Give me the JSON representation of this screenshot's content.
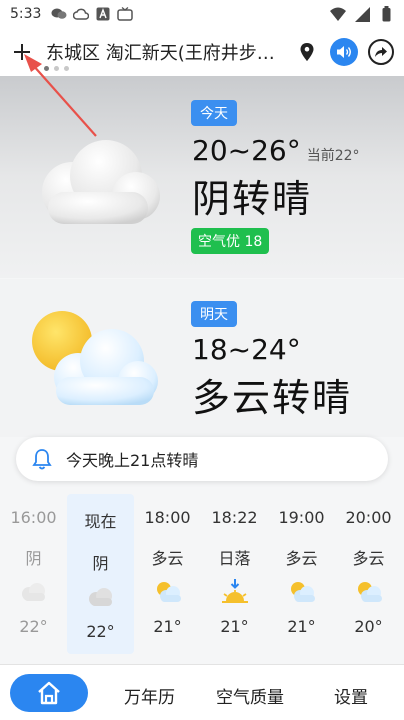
{
  "status_bar": {
    "time": "5:33"
  },
  "header": {
    "location": "东城区 淘汇新天(王府井步…"
  },
  "today": {
    "tag": "今天",
    "temp_range": "20~26°",
    "current": "当前22°",
    "condition": "阴转晴",
    "aqi": "空气优 18"
  },
  "tomorrow": {
    "tag": "明天",
    "temp_range": "18~24°",
    "condition": "多云转晴"
  },
  "alert": {
    "text": "今天晚上21点转晴"
  },
  "hourly": [
    {
      "time": "16:00",
      "cond": "阴",
      "temp": "22°",
      "icon": "cloud-icon"
    },
    {
      "time": "现在",
      "cond": "阴",
      "temp": "22°",
      "icon": "cloud-icon"
    },
    {
      "time": "18:00",
      "cond": "多云",
      "temp": "21°",
      "icon": "partly-cloudy-icon"
    },
    {
      "time": "18:22",
      "cond": "日落",
      "temp": "21°",
      "icon": "sunset-icon"
    },
    {
      "time": "19:00",
      "cond": "多云",
      "temp": "21°",
      "icon": "partly-cloudy-icon"
    },
    {
      "time": "20:00",
      "cond": "多云",
      "temp": "20°",
      "icon": "partly-cloudy-icon"
    }
  ],
  "bottom_nav": {
    "calendar": "万年历",
    "air": "空气质量",
    "settings": "设置"
  },
  "colors": {
    "accent": "#2b86f0",
    "aqi_good": "#1fbf4e",
    "annotation": "#e8514a"
  }
}
